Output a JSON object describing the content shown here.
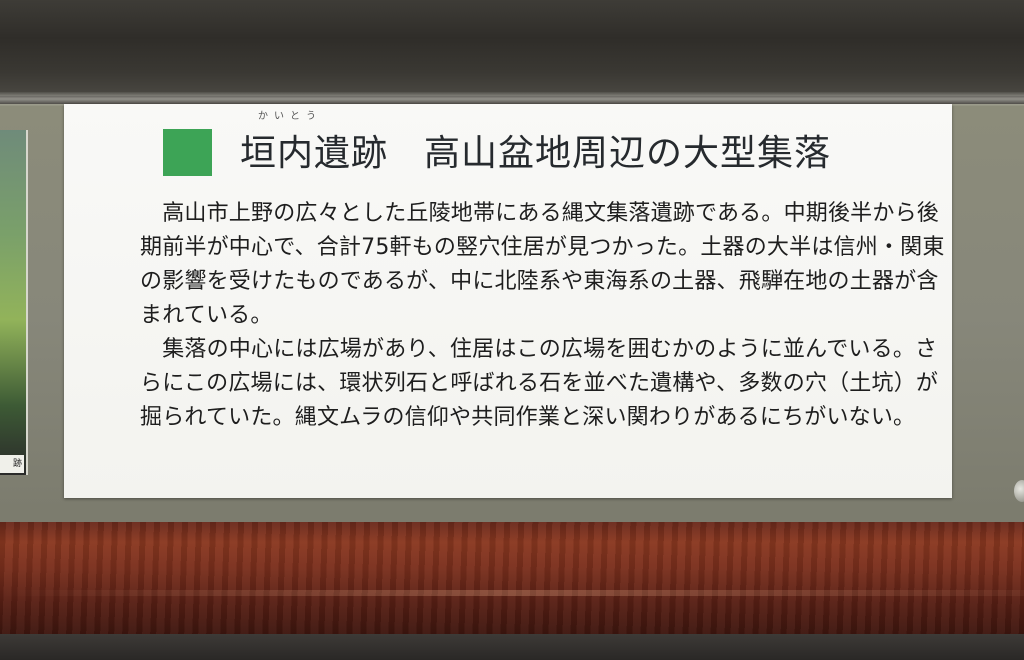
{
  "sign": {
    "ruby": "かいとう",
    "title_site": "垣内遺跡",
    "title_subject": "高山盆地周辺の大型集落",
    "lines": [
      "　高山市上野の広々とした丘陵地帯にある縄文集落遺跡である。中期後半から後",
      "期前半が中心で、合計75軒もの竪穴住居が見つかった。土器の大半は信州・関東",
      "の影響を受けたものであるが、中に北陸系や東海系の土器、飛騨在地の土器が含",
      "まれている。",
      "　集落の中心には広場があり、住居はこの広場を囲むかのように並んでいる。さ",
      "らにこの広場には、環状列石と呼ばれる石を並べた遺構や、多数の穴（土坑）が",
      "掘られていた。縄文ムラの信仰や共同作業と深い関わりがあるにちがいない。"
    ],
    "accent_color": "#3da456"
  },
  "side_photo_caption": "跡"
}
